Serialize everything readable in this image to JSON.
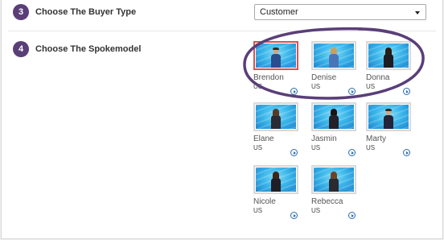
{
  "steps": [
    {
      "number": "3",
      "label": "Choose The Buyer Type"
    },
    {
      "number": "4",
      "label": "Choose The Spokemodel"
    }
  ],
  "buyer_type": {
    "selected": "Customer"
  },
  "models": [
    {
      "name": "Brendon",
      "country": "US",
      "selected": true
    },
    {
      "name": "Denise",
      "country": "US",
      "selected": false
    },
    {
      "name": "Donna",
      "country": "US",
      "selected": false
    },
    {
      "name": "Elane",
      "country": "US",
      "selected": false
    },
    {
      "name": "Jasmin",
      "country": "US",
      "selected": false
    },
    {
      "name": "Marty",
      "country": "US",
      "selected": false
    },
    {
      "name": "Nicole",
      "country": "US",
      "selected": false
    },
    {
      "name": "Rebecca",
      "country": "US",
      "selected": false
    }
  ],
  "colors": {
    "accent": "#5a3e78",
    "selected_border": "#d9534f",
    "play_icon": "#2b6cb0"
  }
}
